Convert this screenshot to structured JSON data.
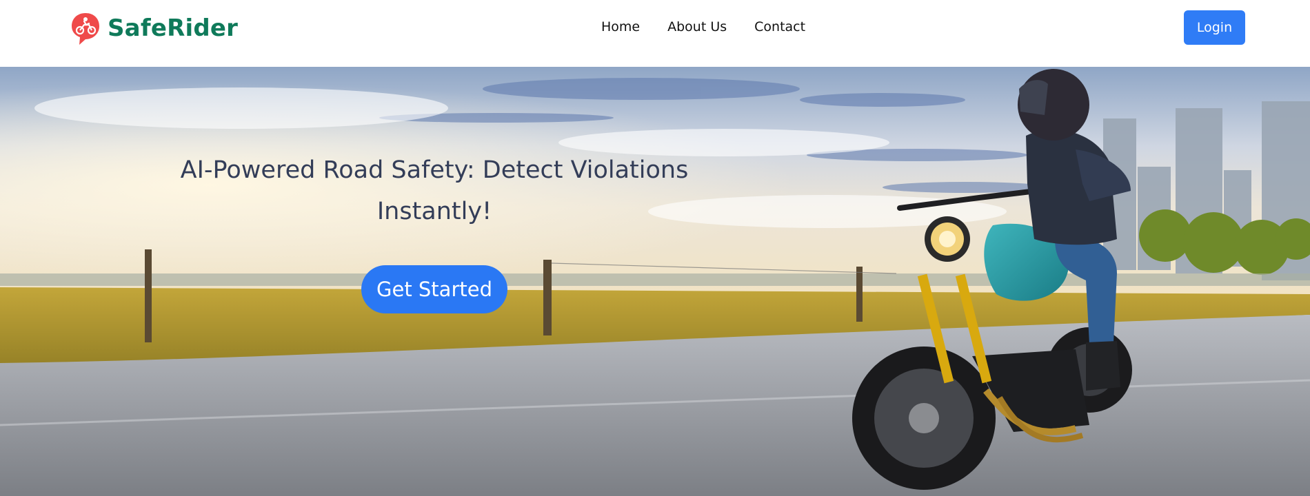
{
  "nav": {
    "brand_name": "SafeRider",
    "links": [
      {
        "label": "Home"
      },
      {
        "label": "About Us"
      },
      {
        "label": "Contact"
      }
    ],
    "login_label": "Login"
  },
  "hero": {
    "title_line_1": "AI-Powered Road Safety: Detect Violations",
    "title_line_2": "Instantly!",
    "cta_label": "Get Started"
  },
  "icons": {
    "brand_logo": "motorcycle-pin-icon"
  },
  "colors": {
    "brand": "#0f7a5a",
    "logo_red": "#ef4a4a",
    "primary": "#2f7cf6",
    "hero_text": "#333d58"
  }
}
